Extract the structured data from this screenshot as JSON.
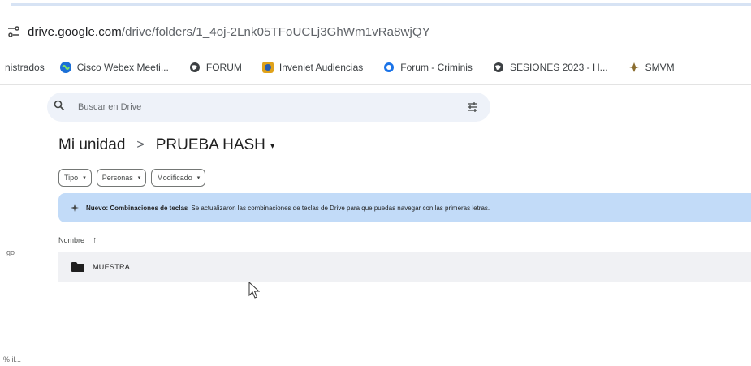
{
  "browser": {
    "url_host": "drive.google.com",
    "url_path": "/drive/folders/1_4oj-2Lnk05TFoUCLj3GhWm1vRa8wjQY"
  },
  "bookmarks": [
    {
      "label": "nistrados",
      "icon": "none"
    },
    {
      "label": "Cisco Webex Meeti...",
      "icon": "webex-icon"
    },
    {
      "label": "FORUM",
      "icon": "globe-icon"
    },
    {
      "label": "Inveniet Audiencias",
      "icon": "app-icon"
    },
    {
      "label": "Forum - Criminis",
      "icon": "forum-icon"
    },
    {
      "label": "SESIONES 2023 - H...",
      "icon": "globe-icon"
    },
    {
      "label": "SMVM",
      "icon": "emblem-icon"
    }
  ],
  "search": {
    "placeholder": "Buscar en Drive"
  },
  "breadcrumb": {
    "root": "Mi unidad",
    "separator": ">",
    "current": "PRUEBA HASH",
    "caret": "▾"
  },
  "filters": [
    {
      "label": "Tipo"
    },
    {
      "label": "Personas"
    },
    {
      "label": "Modificado"
    }
  ],
  "banner": {
    "bold": "Nuevo: Combinaciones de teclas",
    "text": "Se actualizaron las combinaciones de teclas de Drive para que puedas navegar con las primeras letras."
  },
  "table": {
    "header": "Nombre",
    "sort_arrow": "↑",
    "rows": [
      {
        "name": "MUESTRA",
        "type": "folder"
      }
    ]
  },
  "left_fragments": {
    "a": "go",
    "b": "% il..."
  },
  "colors": {
    "banner": "#c2dbf8",
    "search_bg": "#eef2f9",
    "row_bg": "#f0f1f4"
  }
}
